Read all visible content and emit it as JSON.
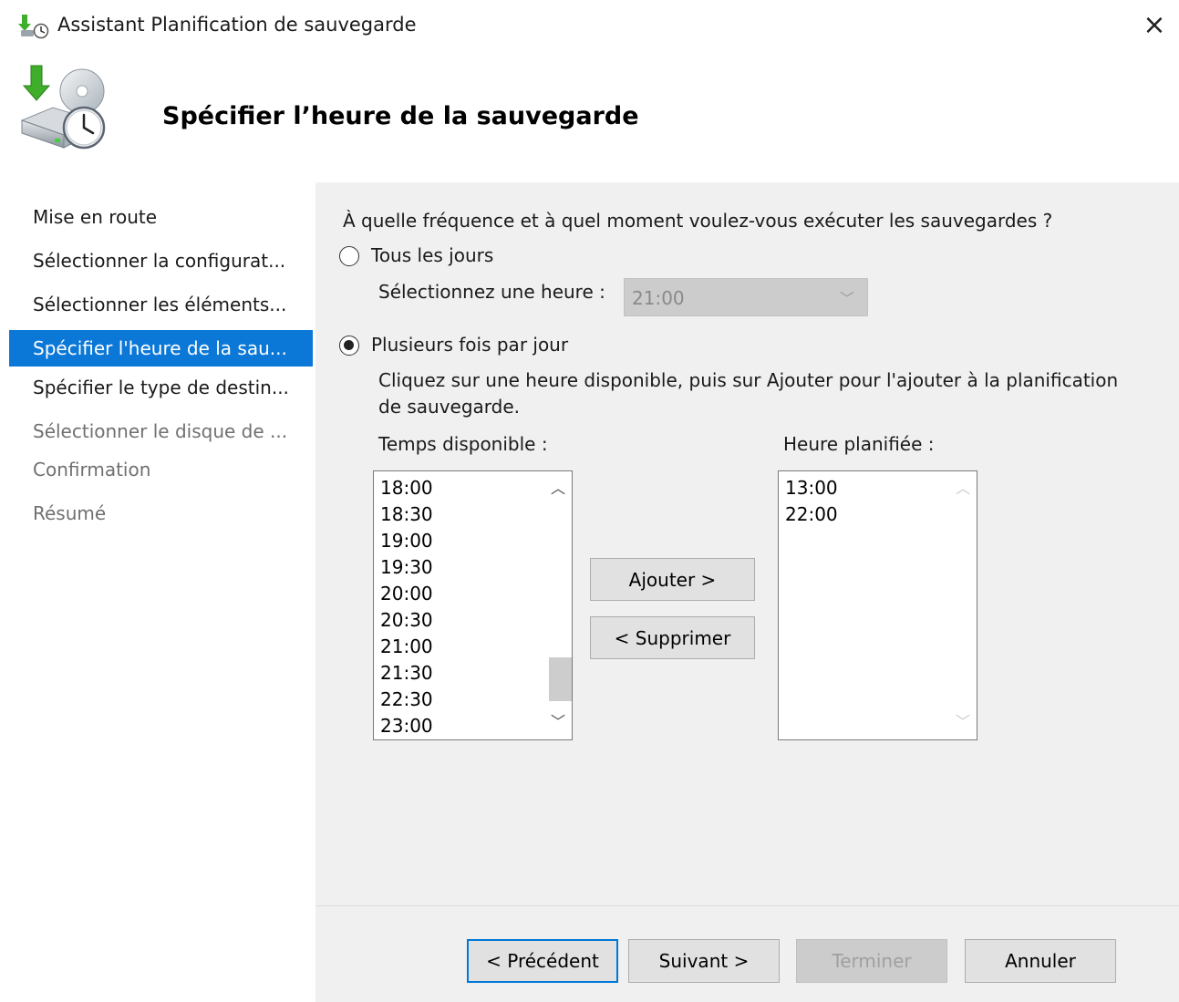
{
  "window": {
    "title": "Assistant Planification de sauvegarde",
    "close_label": "×"
  },
  "header": {
    "title": "Spécifier l’heure de la sauvegarde"
  },
  "sidebar": {
    "items": [
      {
        "label": "Mise en route",
        "state": "done"
      },
      {
        "label": "Sélectionner la configurat...",
        "state": "done"
      },
      {
        "label": "Sélectionner les éléments...",
        "state": "done"
      },
      {
        "label": "Spécifier l'heure de la sau...",
        "state": "active"
      },
      {
        "label": "Spécifier le type de destin...",
        "state": "done"
      },
      {
        "label": "Sélectionner le disque de ...",
        "state": "future"
      },
      {
        "label": "Confirmation",
        "state": "future"
      },
      {
        "label": "Résumé",
        "state": "future"
      }
    ]
  },
  "main": {
    "question": "À quelle fréquence et à quel moment voulez-vous exécuter les sauvegardes ?",
    "option_daily": {
      "label": "Tous les jours",
      "checked": false
    },
    "select_time_label": "Sélectionnez une heure :",
    "time_combo": {
      "value": "21:00",
      "disabled": true
    },
    "option_multiple": {
      "label": "Plusieurs fois par jour",
      "checked": true
    },
    "instruction_line1": "Cliquez sur une heure disponible, puis sur Ajouter pour l'ajouter à la planification",
    "instruction_line2": "de sauvegarde.",
    "available_label": "Temps disponible :",
    "available_times": [
      "18:00",
      "18:30",
      "19:00",
      "19:30",
      "20:00",
      "20:30",
      "21:00",
      "21:30",
      "22:30",
      "23:00"
    ],
    "scheduled_label": "Heure planifiée :",
    "scheduled_times": [
      "13:00",
      "22:00"
    ],
    "add_button": "Ajouter >",
    "remove_button": "< Supprimer"
  },
  "footer": {
    "previous": "< Précédent",
    "next": "Suivant >",
    "finish": "Terminer",
    "cancel": "Annuler"
  },
  "colors": {
    "accent": "#0b78d7",
    "panel_bg": "#f0f0f0",
    "disabled_bg": "#cccccc"
  }
}
